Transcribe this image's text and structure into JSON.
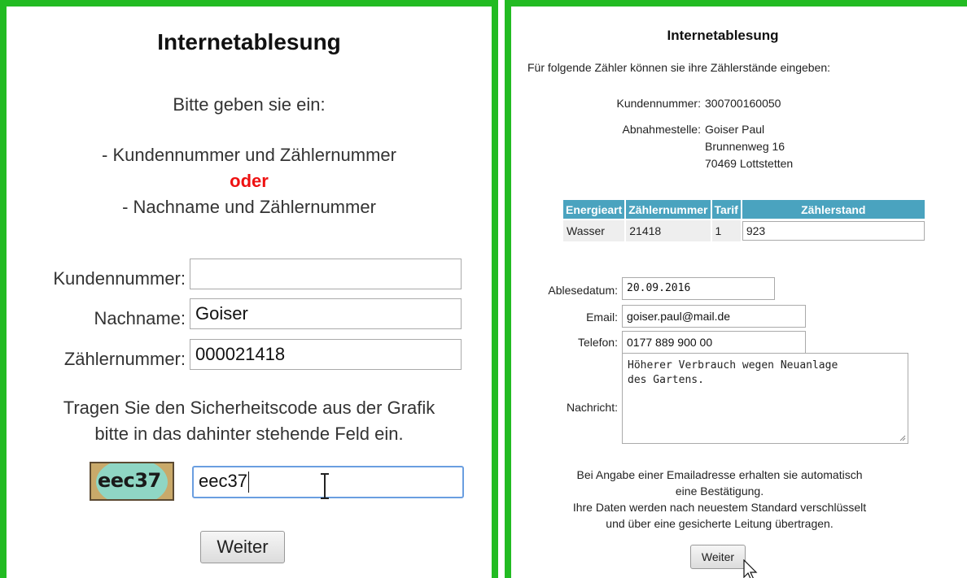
{
  "left": {
    "title": "Internetablesung",
    "intro": "Bitte geben sie ein:",
    "option1": "- Kundennummer und Zählernummer",
    "oder": "oder",
    "option2": "- Nachname und Zählernummer",
    "fields": {
      "kundennummer_label": "Kundennummer:",
      "kundennummer_value": "",
      "nachname_label": "Nachname:",
      "nachname_value": "Goiser",
      "zaehlernummer_label": "Zählernummer:",
      "zaehlernummer_value": "000021418"
    },
    "captcha_text_line1": "Tragen Sie den Sicherheitscode aus der Grafik",
    "captcha_text_line2": "bitte in das dahinter stehende Feld ein.",
    "captcha_image_text": "eec37",
    "captcha_input_value": "eec37",
    "submit_label": "Weiter"
  },
  "right": {
    "title": "Internetablesung",
    "intro": "Für folgende Zähler können sie ihre Zählerstände eingeben:",
    "kundennummer_label": "Kundennummer:",
    "kundennummer_value": "300700160050",
    "abnahmestelle_label": "Abnahmestelle:",
    "abnahmestelle_lines": [
      "Goiser Paul",
      "Brunnenweg 16",
      "70469 Lottstetten"
    ],
    "table": {
      "headers": [
        "Energieart",
        "Zählernummer",
        "Tarif",
        "Zählerstand"
      ],
      "rows": [
        {
          "energieart": "Wasser",
          "zaehlernummer": "21418",
          "tarif": "1",
          "zaehlerstand": "923"
        }
      ]
    },
    "ablesedatum_label": "Ablesedatum:",
    "ablesedatum_value": "20.09.2016",
    "email_label": "Email:",
    "email_value": "goiser.paul@mail.de",
    "telefon_label": "Telefon:",
    "telefon_value": "0177 889 900 00",
    "nachricht_label": "Nachricht:",
    "nachricht_value": "Höherer Verbrauch wegen Neuanlage\ndes Gartens.",
    "bottom_lines": [
      "Bei Angabe einer Emailadresse erhalten sie automatisch",
      "eine Bestätigung.",
      "Ihre Daten werden nach neuestem Standard verschlüsselt",
      "und über eine gesicherte Leitung übertragen."
    ],
    "submit_label": "Weiter"
  },
  "colors": {
    "frame_green": "#22bb22",
    "oder_red": "#ee1111",
    "table_header": "#4aa3bf",
    "focus_blue": "#6a9ee0"
  },
  "icons": [
    "text-cursor-icon",
    "mouse-pointer-icon",
    "resize-grip-icon"
  ]
}
